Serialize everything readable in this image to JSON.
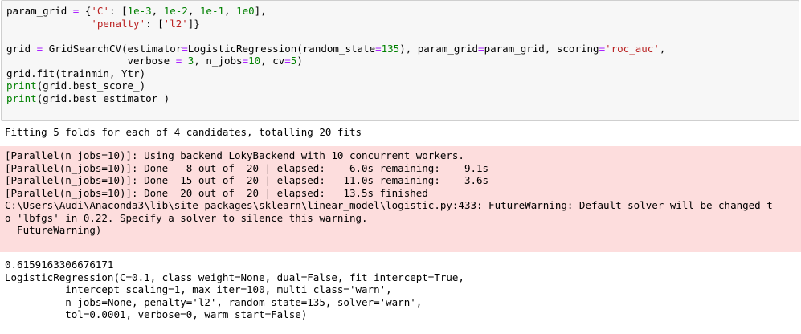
{
  "code_cell": {
    "line1": {
      "a": "param_grid ",
      "eq": "=",
      "b": " {",
      "s1": "'C'",
      "c": ": [",
      "n1": "1e-3",
      "d": ", ",
      "n2": "1e-2",
      "e": ", ",
      "n3": "1e-1",
      "f": ", ",
      "n4": "1e0",
      "g": "],"
    },
    "line2": {
      "indent": "              ",
      "s1": "'penalty'",
      "a": ": [",
      "s2": "'l2'",
      "b": "]}"
    },
    "line3": {
      "text": ""
    },
    "line4": {
      "a": "grid ",
      "eq": "=",
      "b": " GridSearchCV(estimator",
      "eq2": "=",
      "c": "LogisticRegression(random_state",
      "eq3": "=",
      "n1": "135",
      "d": "), param_grid",
      "eq4": "=",
      "e": "param_grid, scoring",
      "eq5": "=",
      "s1": "'roc_auc'",
      "f": ","
    },
    "line5": {
      "indent": "                    ",
      "a": "verbose ",
      "eq": "=",
      "b": " ",
      "n1": "3",
      "c": ", n_jobs",
      "eq2": "=",
      "n2": "10",
      "d": ", cv",
      "eq3": "=",
      "n3": "5",
      "e": ")"
    },
    "line6": {
      "text": "grid.fit(trainmin, Ytr)"
    },
    "line7": {
      "kw": "print",
      "rest": "(grid.best_score_)"
    },
    "line8": {
      "kw": "print",
      "rest": "(grid.best_estimator_)"
    }
  },
  "stdout_text": "Fitting 5 folds for each of 4 candidates, totalling 20 fits",
  "stderr_lines": [
    "[Parallel(n_jobs=10)]: Using backend LokyBackend with 10 concurrent workers.",
    "[Parallel(n_jobs=10)]: Done   8 out of  20 | elapsed:    6.0s remaining:    9.1s",
    "[Parallel(n_jobs=10)]: Done  15 out of  20 | elapsed:   11.0s remaining:    3.6s",
    "[Parallel(n_jobs=10)]: Done  20 out of  20 | elapsed:   13.5s finished",
    "C:\\Users\\Audi\\Anaconda3\\lib\\site-packages\\sklearn\\linear_model\\logistic.py:433: FutureWarning: Default solver will be changed t",
    "o 'lbfgs' in 0.22. Specify a solver to silence this warning.",
    "  FutureWarning)"
  ],
  "result_lines": [
    "0.6159163306676171",
    "LogisticRegression(C=0.1, class_weight=None, dual=False, fit_intercept=True,",
    "          intercept_scaling=1, max_iter=100, multi_class='warn',",
    "          n_jobs=None, penalty='l2', random_state=135, solver='warn',",
    "          tol=0.0001, verbose=0, warm_start=False)"
  ],
  "colors": {
    "cell_background": "#f7f7f7",
    "cell_border": "#cfcfcf",
    "stderr_background": "#fddddd",
    "keyword": "#008000",
    "string": "#ba2121",
    "operator": "#aa22ff"
  }
}
